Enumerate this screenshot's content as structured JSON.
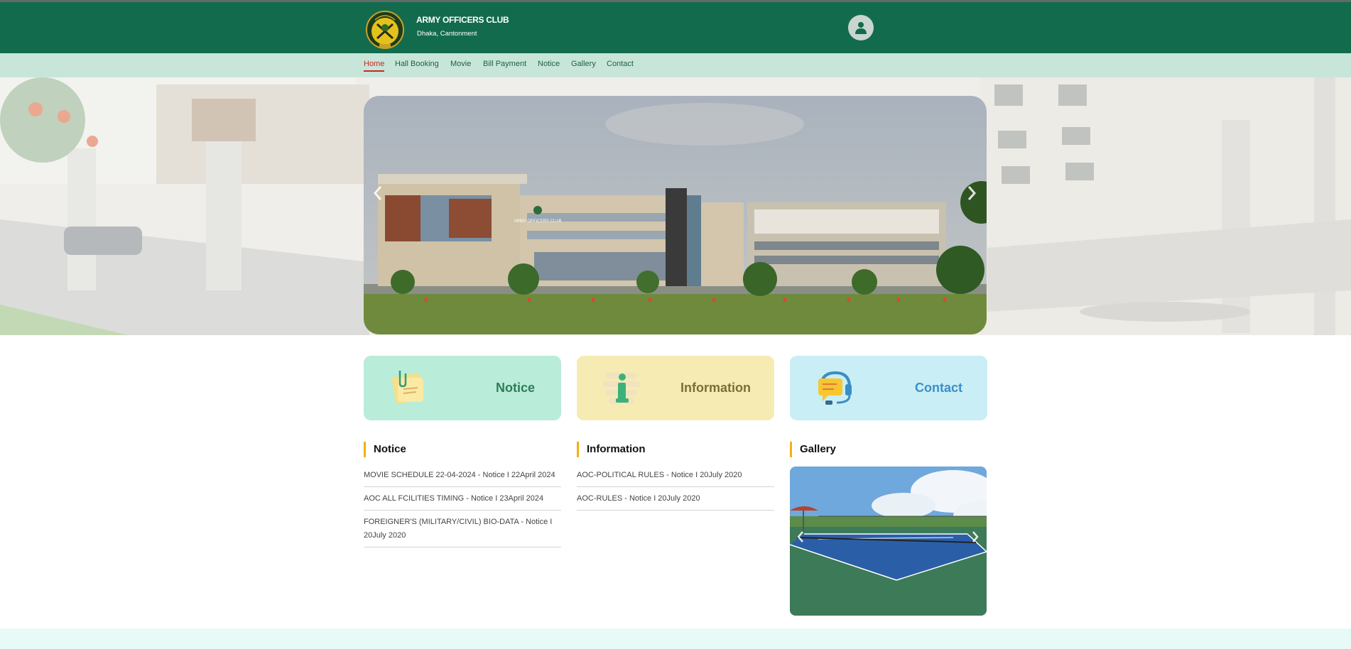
{
  "header": {
    "title": "ARMY OFFICERS CLUB",
    "subtitle": "Dhaka, Cantonment",
    "logo_icon": "club-crest-icon",
    "profile_icon": "user-icon"
  },
  "nav": {
    "items": [
      {
        "label": "Home",
        "active": true
      },
      {
        "label": "Hall Booking",
        "active": false
      },
      {
        "label": "Movie",
        "active": false
      },
      {
        "label": "Bill Payment",
        "active": false
      },
      {
        "label": "Notice",
        "active": false
      },
      {
        "label": "Gallery",
        "active": false
      },
      {
        "label": "Contact",
        "active": false
      }
    ]
  },
  "hero": {
    "prev_icon": "chevron-left-icon",
    "next_icon": "chevron-right-icon",
    "slide_signage": "ARMY OFFICERS CLUB"
  },
  "tiles": [
    {
      "label": "Notice",
      "icon": "sticky-note-icon",
      "bg": "#b9ecd9",
      "color": "#2e7d58"
    },
    {
      "label": "Information",
      "icon": "info-icon",
      "bg": "#f5ebb3",
      "color": "#7d6d3a"
    },
    {
      "label": "Contact",
      "icon": "headset-chat-icon",
      "bg": "#c9eef6",
      "color": "#3b8fc7"
    }
  ],
  "sections": {
    "notice": {
      "heading": "Notice",
      "items": [
        "MOVIE SCHEDULE 22-04-2024 - Notice I 22April 2024",
        "AOC ALL FCILITIES TIMING - Notice I 23April 2024",
        "FOREIGNER'S (MILITARY/CIVIL) BIO-DATA - Notice I 20July 2020"
      ]
    },
    "information": {
      "heading": "Information",
      "items": [
        "AOC-POLITICAL RULES - Notice I 20July 2020",
        "AOC-RULES - Notice I 20July 2020"
      ]
    },
    "gallery": {
      "heading": "Gallery",
      "prev_icon": "chevron-left-icon",
      "next_icon": "chevron-right-icon"
    }
  },
  "colors": {
    "header_bg": "#136b4d",
    "nav_bg": "#c7e6d9",
    "active_nav": "#c62828",
    "section_accent": "#f1b20f"
  }
}
